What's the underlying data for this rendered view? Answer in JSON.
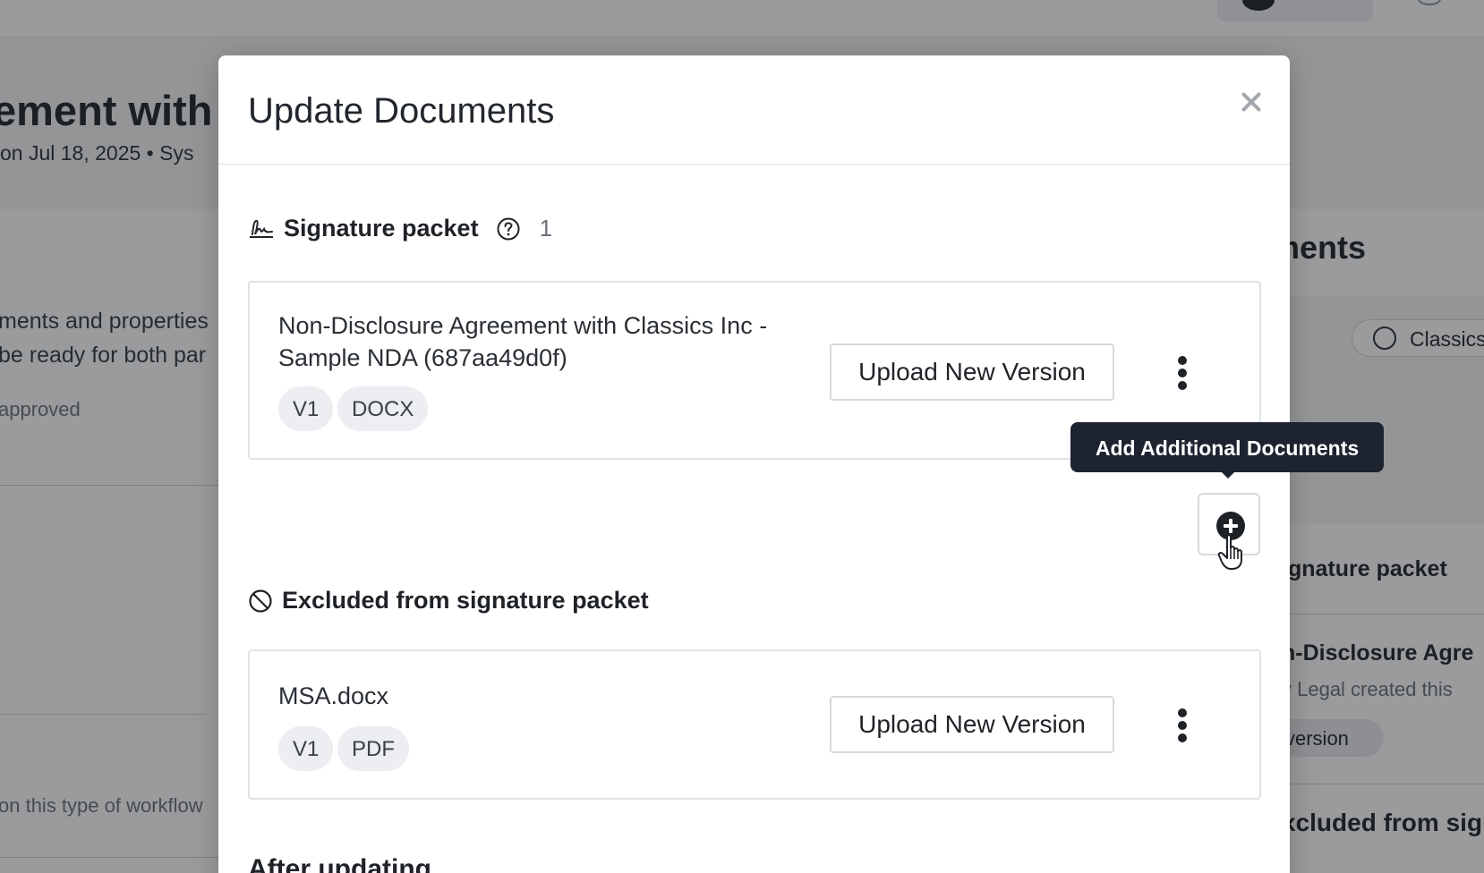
{
  "background": {
    "title": "ement with",
    "subtitle": "on Jul 18, 2025  •  Sys",
    "left_line_1": "ments and properties",
    "left_line_2": "be ready for both par",
    "left_line_3": "approved",
    "left_line_4": "on this type of workflow",
    "right_title": "ments",
    "right_pill": "Classics",
    "right_section": "ignature packet",
    "right_doc": "n-Disclosure Agre",
    "right_meta": "y Legal created this",
    "right_version_pill": "version",
    "right_excluded": "xcluded from sign"
  },
  "modal": {
    "title": "Update Documents",
    "signature_section": {
      "label": "Signature packet",
      "count": "1",
      "documents": [
        {
          "name": "Non-Disclosure Agreement with Classics Inc - Sample NDA (687aa49d0f)",
          "tags": [
            "V1",
            "DOCX"
          ],
          "upload_label": "Upload New Version"
        }
      ]
    },
    "add_tooltip": "Add Additional Documents",
    "excluded_section": {
      "label": "Excluded from signature packet",
      "documents": [
        {
          "name": "MSA.docx",
          "tags": [
            "V1",
            "PDF"
          ],
          "upload_label": "Upload New Version"
        }
      ]
    },
    "after_label": "After updating"
  },
  "icons": {
    "close": "close-icon",
    "signature": "signature-icon",
    "help": "help-circle-icon",
    "more": "more-vertical-icon",
    "add": "plus-circle-icon",
    "excluded": "ban-icon",
    "cursor": "hand-pointer-cursor"
  },
  "colors": {
    "tooltip_bg": "#1d2430",
    "overlay": "rgba(25,27,30,0.44)",
    "tag_bg": "#eceef1"
  }
}
